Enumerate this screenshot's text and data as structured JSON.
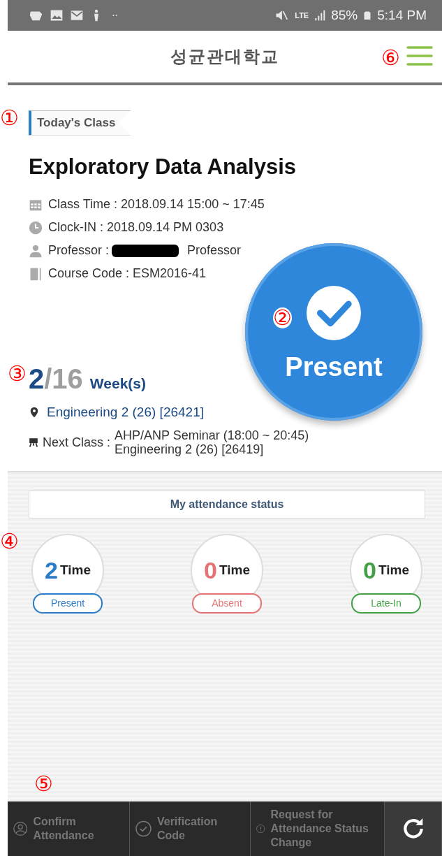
{
  "status_bar": {
    "battery": "85%",
    "time": "5:14 PM",
    "network": "LTE"
  },
  "header": {
    "title": "성균관대학교",
    "menu_callout": "⑥"
  },
  "today": {
    "callout": "①",
    "tag": "Today's Class",
    "course_title": "Exploratory Data Analysis",
    "details": [
      {
        "kind": "calendar",
        "text": "Class Time : 2018.09.14 15:00 ~ 17:45"
      },
      {
        "kind": "clock",
        "text": "Clock-IN : 2018.09.14 PM 0303"
      },
      {
        "kind": "person",
        "prefix": "Professor :",
        "suffix": "Professor"
      },
      {
        "kind": "book",
        "text": "Course Code : ESM2016-41"
      }
    ],
    "attendance_button": {
      "callout": "②",
      "label": "Present"
    },
    "week": {
      "callout": "③",
      "current": "2",
      "separator": "/",
      "total": "16",
      "unit": "Week(s)"
    },
    "location": "Engineering 2 (26) [26421]",
    "next_class": {
      "label": "Next Class :",
      "lines": [
        "AHP/ANP Seminar (18:00 ~ 20:45)",
        "Engineering 2 (26) [26419]"
      ]
    }
  },
  "attendance_status": {
    "title": "My attendance status",
    "callout": "④",
    "items": [
      {
        "count": "2",
        "unit": "Time",
        "label": "Present",
        "color": "#2b7cc8"
      },
      {
        "count": "0",
        "unit": "Time",
        "label": "Absent",
        "color": "#e57373"
      },
      {
        "count": "0",
        "unit": "Time",
        "label": "Late-In",
        "color": "#43a047"
      }
    ]
  },
  "bottom_nav": {
    "callout": "⑤",
    "items": [
      {
        "kind": "person",
        "label": "Confirm Attendance"
      },
      {
        "kind": "check",
        "label": "Verification Code"
      },
      {
        "kind": "alert",
        "label": "Request for Attendance Status Change"
      },
      {
        "kind": "refresh"
      }
    ]
  }
}
